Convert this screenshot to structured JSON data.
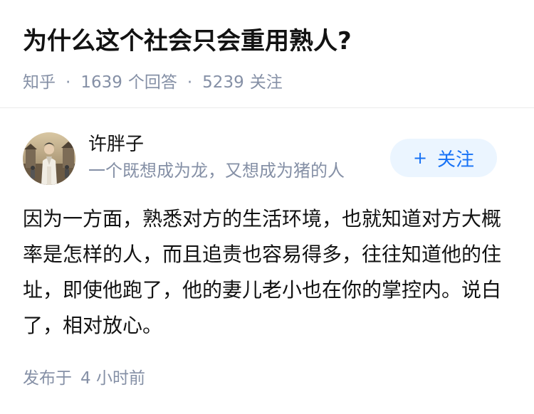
{
  "question": {
    "title": "为什么这个社会只会重用熟人?",
    "source": "知乎",
    "answers_count": "1639",
    "answers_label": "个回答",
    "followers_count": "5239",
    "followers_label": "关注"
  },
  "author": {
    "name": "许胖子",
    "bio": "一个既想成为龙，又想成为猪的人",
    "follow_plus": "+",
    "follow_label": "关注"
  },
  "answer": {
    "content": "因为一方面，熟悉对方的生活环境，也就知道对方大概率是怎样的人，而且追责也容易得多，往往知道他的住址，即使他跑了，他的妻儿老小也在你的掌控内。说白了，相对放心。"
  },
  "footer": {
    "published_label": "发布于",
    "published_time": "4 小时前"
  },
  "colors": {
    "primary_text": "#121212",
    "meta_text": "#8590a6",
    "accent_blue": "#1772f6",
    "follow_bg": "#ebf5ff",
    "divider": "#ebebeb"
  }
}
